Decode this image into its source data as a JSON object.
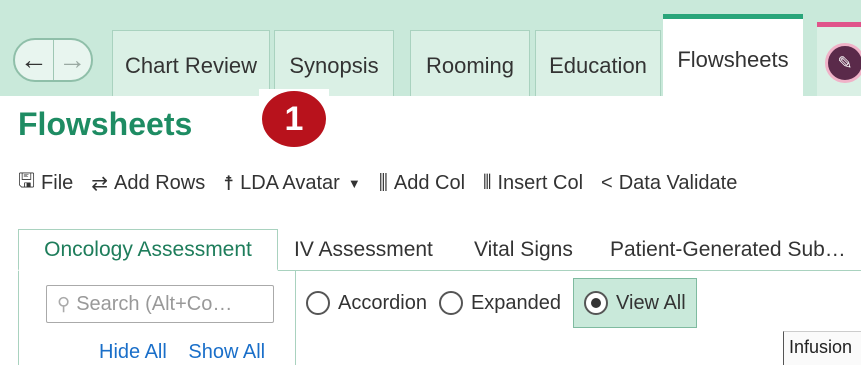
{
  "nav": {
    "back_icon": "arrow-left-icon",
    "forward_icon": "arrow-right-icon"
  },
  "tabs": [
    {
      "label": "Chart Review"
    },
    {
      "label": "Synopsis"
    },
    {
      "label": "Rooming"
    },
    {
      "label": "Education"
    },
    {
      "label": "Flowsheets",
      "active": true
    }
  ],
  "page": {
    "title": "Flowsheets",
    "badge": "1"
  },
  "toolbar": {
    "file": "File",
    "add_rows": "Add Rows",
    "lda_avatar": "LDA Avatar",
    "add_col": "Add Col",
    "insert_col": "Insert Col",
    "data_validate": "Data Validate"
  },
  "subtabs": [
    {
      "label": "Oncology Assessment",
      "active": true
    },
    {
      "label": "IV Assessment"
    },
    {
      "label": "Vital Signs"
    },
    {
      "label": "Patient-Generated Sub…"
    }
  ],
  "search": {
    "placeholder": "Search (Alt+Co…"
  },
  "links": {
    "hide_all": "Hide All",
    "show_all": "Show All"
  },
  "view_modes": {
    "accordion": "Accordion",
    "expanded": "Expanded",
    "view_all": "View All",
    "selected": "View All"
  },
  "grid": {
    "column_header": "Infusion"
  },
  "colors": {
    "accent": "#1e8c63",
    "tab_strip": "#c9e9da",
    "badge": "#b8121c",
    "link": "#1a6fc9"
  }
}
